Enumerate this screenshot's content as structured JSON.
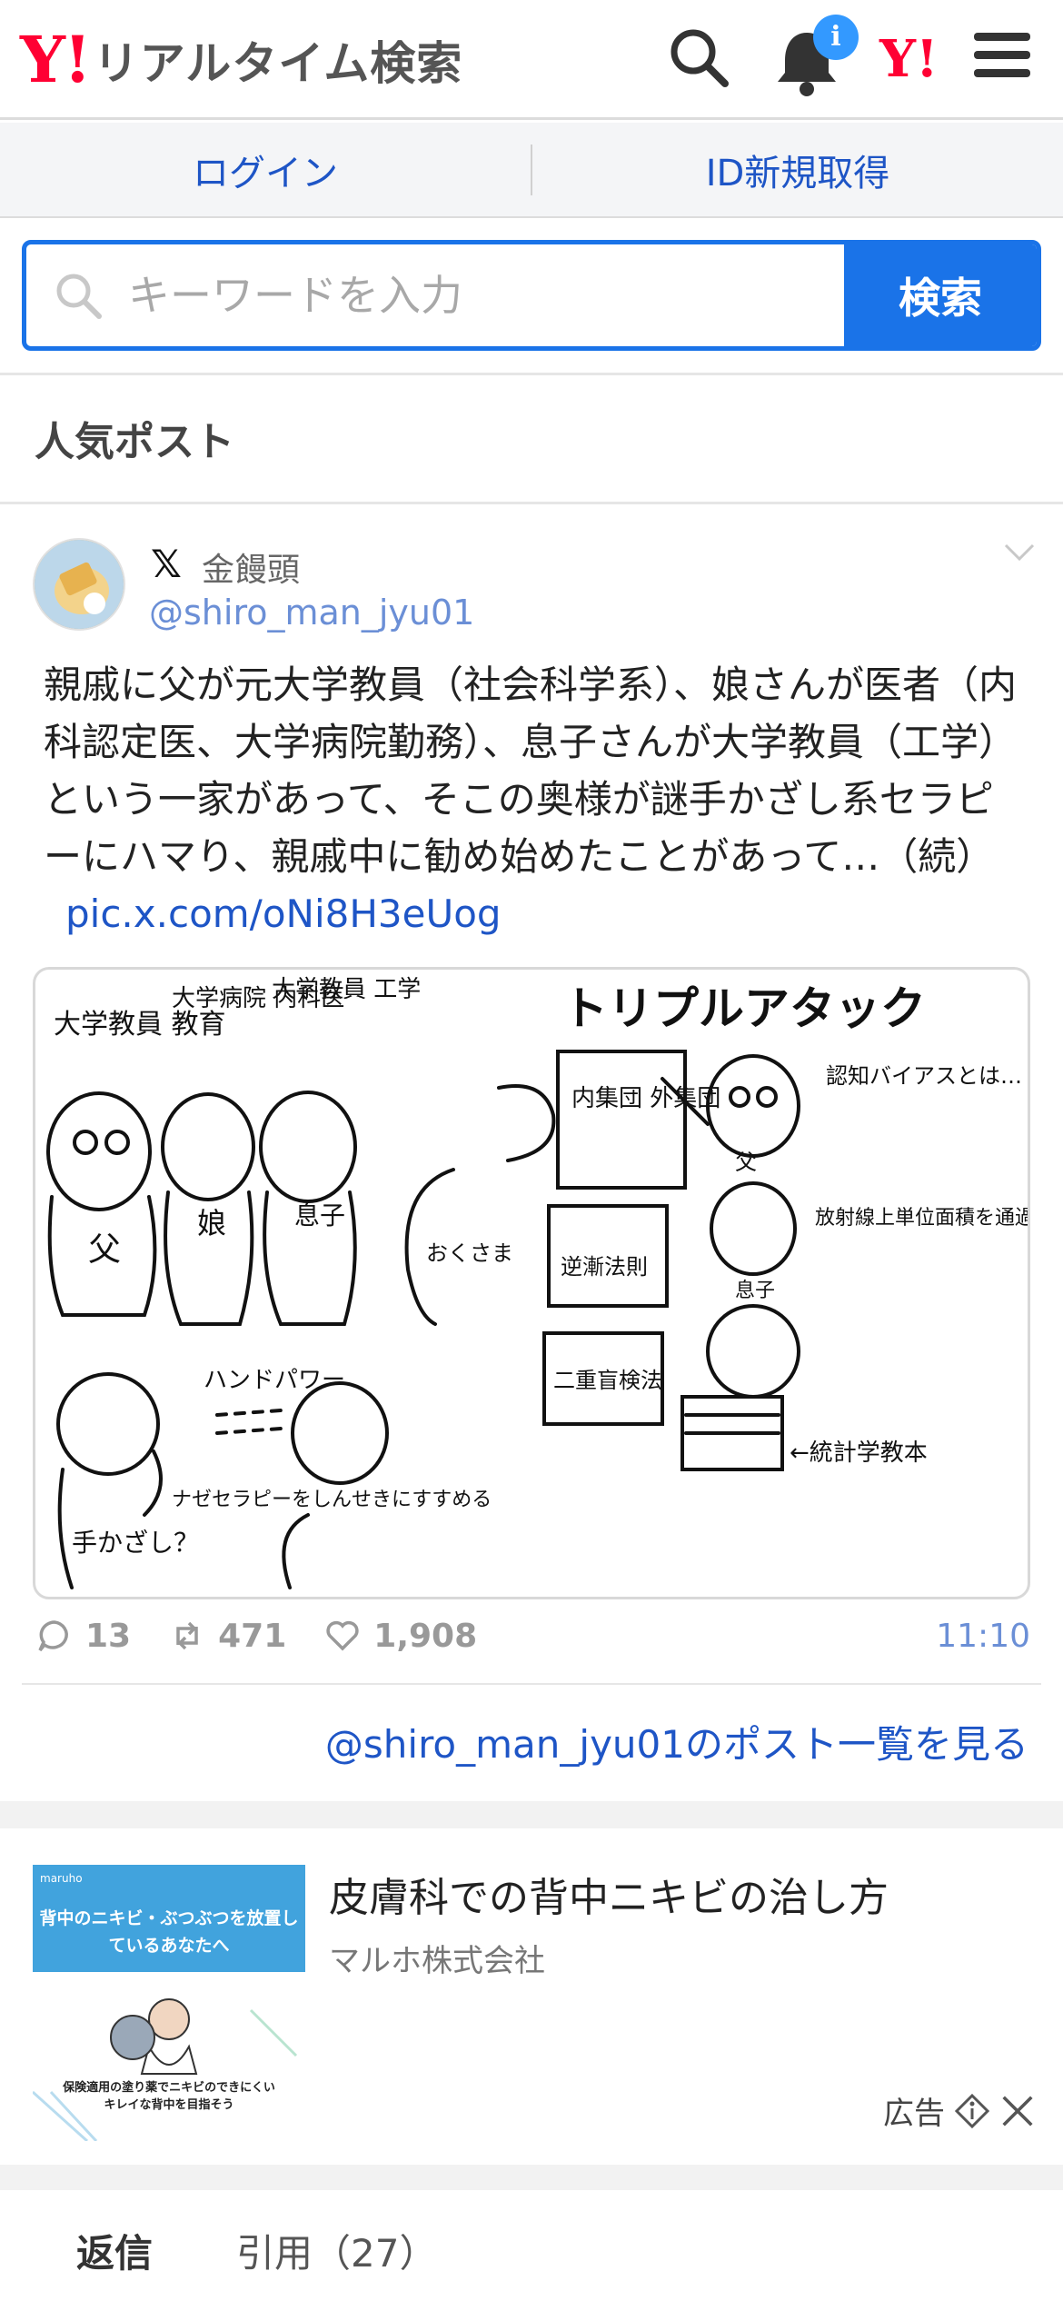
{
  "header": {
    "logo_mark": "Y!",
    "logo_text": "リアルタイム検索",
    "notification_badge": "i",
    "yahoo_mark": "Y!"
  },
  "login_bar": {
    "login": "ログイン",
    "signup": "ID新規取得"
  },
  "search": {
    "placeholder": "キーワードを入力",
    "button": "検索"
  },
  "section_title": "人気ポスト",
  "post": {
    "author_name": "金饅頭",
    "author_handle": "@shiro_man_jyu01",
    "source_icon": "x-logo-icon",
    "text": "親戚に父が元大学教員（社会科学系）、娘さんが医者（内科認定医、大学病院勤務）、息子さんが大学教員（工学）という一家があって、そこの奥様が謎手かざし系セラピーにハマり、親戚中に勧め始めたことがあって…（続）",
    "link": "pic.x.com/oNi8H3eUog",
    "image_texts": {
      "title": "トリプルアタック",
      "dad_label": "大学教員 教育",
      "daughter_label": "大学病院 内科医",
      "son_label": "大学教員 工学",
      "dad": "父",
      "daughter": "娘",
      "son": "息子",
      "mom": "おくさま",
      "board1": "内集団 外集団",
      "board2": "逆漸法則",
      "board3": "二重盲検法",
      "bias": "認知バイアスとは…",
      "physics": "放射線上単位面積を通過するエネルギーは一定なので…",
      "stats_book": "←統計学教本",
      "handpower": "ハンドパワー",
      "question": "手かざし？",
      "why": "ナゼセラピーをしんせきにすすめる",
      "dad_small": "父",
      "son_small": "息子"
    },
    "replies": "13",
    "reposts": "471",
    "likes": "1,908",
    "time": "11:10",
    "more_link": "@shiro_man_jyu01のポスト一覧を見る"
  },
  "ad": {
    "brand": "maruho",
    "image_headline": "背中のニキビ・ぶつぶつを放置しているあなたへ",
    "image_caption": "保険適用の塗り薬でニキビのできにくいキレイな背中を目指そう",
    "title": "皮膚科での背中ニキビの治し方",
    "company": "マルホ株式会社",
    "label": "広告"
  },
  "tabs": [
    {
      "label": "返信",
      "active": true
    },
    {
      "label": "引用（27）",
      "active": false
    }
  ],
  "colors": {
    "brand_red": "#ff0033",
    "accent_blue": "#1a73e8",
    "link_blue": "#1e55c6",
    "muted": "#999999"
  }
}
